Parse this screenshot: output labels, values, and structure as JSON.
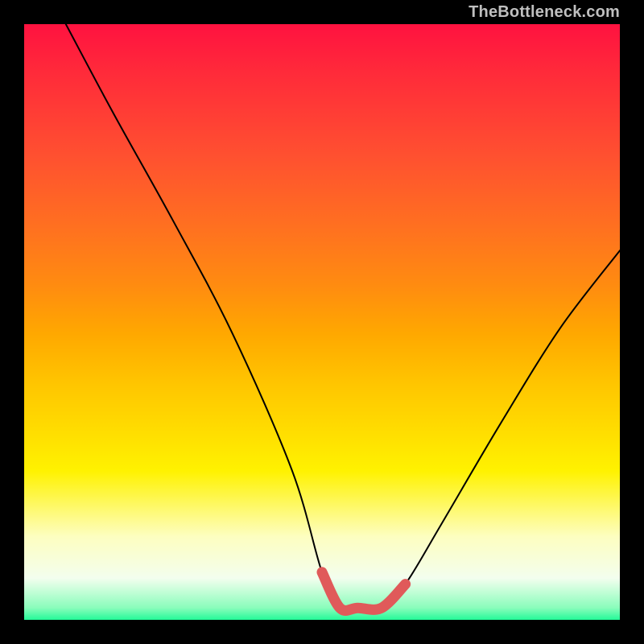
{
  "watermark": "TheBottleneck.com",
  "chart_data": {
    "type": "line",
    "title": "",
    "xlabel": "",
    "ylabel": "",
    "xlim": [
      0,
      100
    ],
    "ylim": [
      0,
      100
    ],
    "grid": false,
    "legend": false,
    "series": [
      {
        "name": "bottleneck-curve",
        "color": "#000000",
        "x": [
          7,
          15,
          25,
          35,
          45,
          50,
          53,
          56,
          60,
          64,
          70,
          80,
          90,
          100
        ],
        "values": [
          100,
          85,
          67,
          48,
          25,
          8,
          2,
          2,
          2,
          6,
          16,
          33,
          49,
          62
        ]
      },
      {
        "name": "optimal-band",
        "color": "#e05a5a",
        "x": [
          50,
          53,
          56,
          60,
          64
        ],
        "values": [
          8,
          2,
          2,
          2,
          6
        ]
      }
    ],
    "gradient_stops": [
      {
        "pos": 0.0,
        "color": "#ff1240"
      },
      {
        "pos": 0.08,
        "color": "#ff2a3a"
      },
      {
        "pos": 0.22,
        "color": "#ff5030"
      },
      {
        "pos": 0.34,
        "color": "#ff7020"
      },
      {
        "pos": 0.44,
        "color": "#ff8c10"
      },
      {
        "pos": 0.52,
        "color": "#ffa800"
      },
      {
        "pos": 0.6,
        "color": "#ffc400"
      },
      {
        "pos": 0.68,
        "color": "#ffdc00"
      },
      {
        "pos": 0.75,
        "color": "#fff200"
      },
      {
        "pos": 0.86,
        "color": "#fdfec0"
      },
      {
        "pos": 0.93,
        "color": "#f3feee"
      },
      {
        "pos": 0.98,
        "color": "#89fdbb"
      },
      {
        "pos": 1.0,
        "color": "#23f998"
      }
    ]
  }
}
